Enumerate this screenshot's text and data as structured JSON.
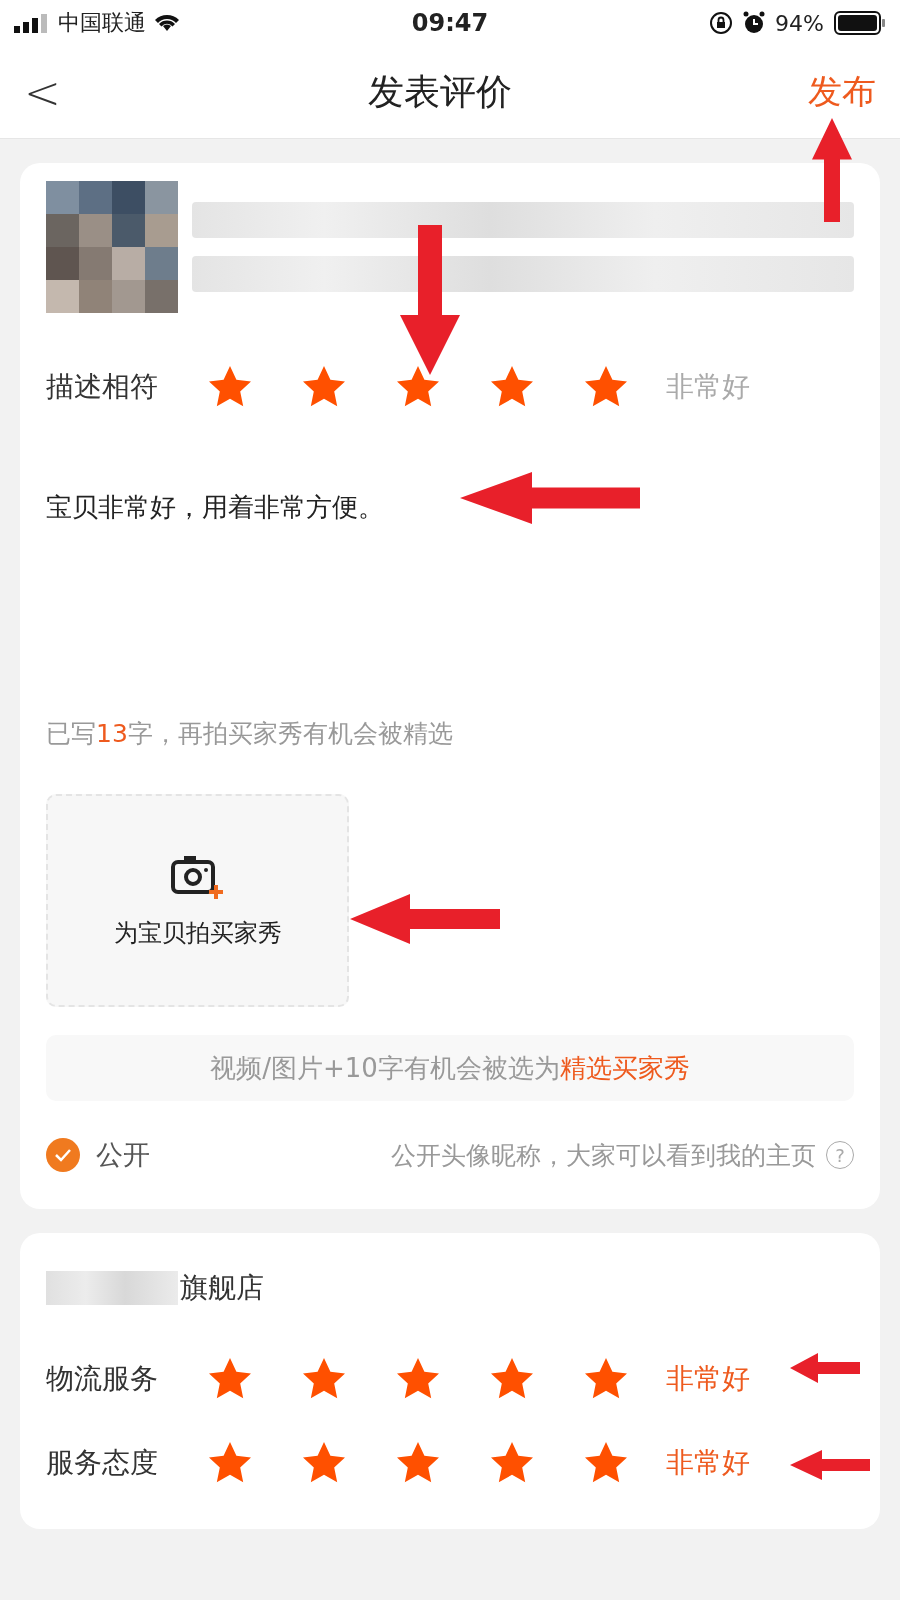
{
  "status_bar": {
    "carrier": "中国联通",
    "time": "09:47",
    "battery": "94%"
  },
  "nav": {
    "back": "<",
    "title": "发表评价",
    "action": "发布"
  },
  "product": {
    "rating": {
      "label": "描述相符",
      "stars": 5,
      "verdict": "非常好",
      "active": false
    }
  },
  "review": {
    "value": "宝贝非常好，用着非常方便。"
  },
  "hint": {
    "before": "已写",
    "count": "13",
    "after": "字，再拍买家秀有机会被精选"
  },
  "upload": {
    "label": "为宝贝拍买家秀"
  },
  "tip": {
    "text": "视频/图片+10字有机会被选为",
    "highlight": "精选买家秀"
  },
  "public": {
    "label": "公开",
    "checked": true,
    "note": "公开头像昵称，大家可以看到我的主页",
    "help": "?"
  },
  "store": {
    "name": "旗舰店",
    "ratings": [
      {
        "label": "物流服务",
        "stars": 5,
        "verdict": "非常好",
        "active": true
      },
      {
        "label": "服务态度",
        "stars": 5,
        "verdict": "非常好",
        "active": true
      }
    ]
  }
}
